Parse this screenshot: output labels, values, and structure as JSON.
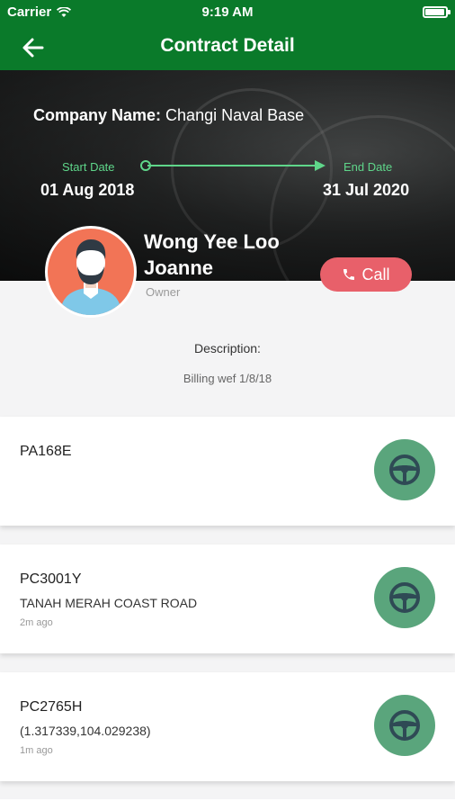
{
  "status_bar": {
    "carrier": "Carrier",
    "time": "9:19 AM",
    "battery_fraction": 0.95
  },
  "nav": {
    "title": "Contract Detail",
    "back_icon": "arrow-left-icon"
  },
  "contract": {
    "company_label": "Company Name:",
    "company_name": "Changi Naval Base",
    "start_label": "Start Date",
    "start_date": "01 Aug 2018",
    "end_label": "End Date",
    "end_date": "31 Jul 2020"
  },
  "contact": {
    "name": "Wong Yee Loo Joanne",
    "role": "Owner",
    "call_label": "Call",
    "call_icon": "phone-icon"
  },
  "description": {
    "label": "Description:",
    "value": "Billing wef 1/8/18"
  },
  "vehicles": [
    {
      "plate": "PA168E",
      "location": "",
      "ago": ""
    },
    {
      "plate": "PC3001Y",
      "location": "TANAH MERAH COAST ROAD",
      "ago": "2m ago"
    },
    {
      "plate": "PC2765H",
      "location": "(1.317339,104.029238)",
      "ago": "1m ago"
    }
  ],
  "colors": {
    "primary": "#0a7a2a",
    "accent": "#5fd68a",
    "call": "#e8606a",
    "wheel_button": "#5aa57c"
  }
}
